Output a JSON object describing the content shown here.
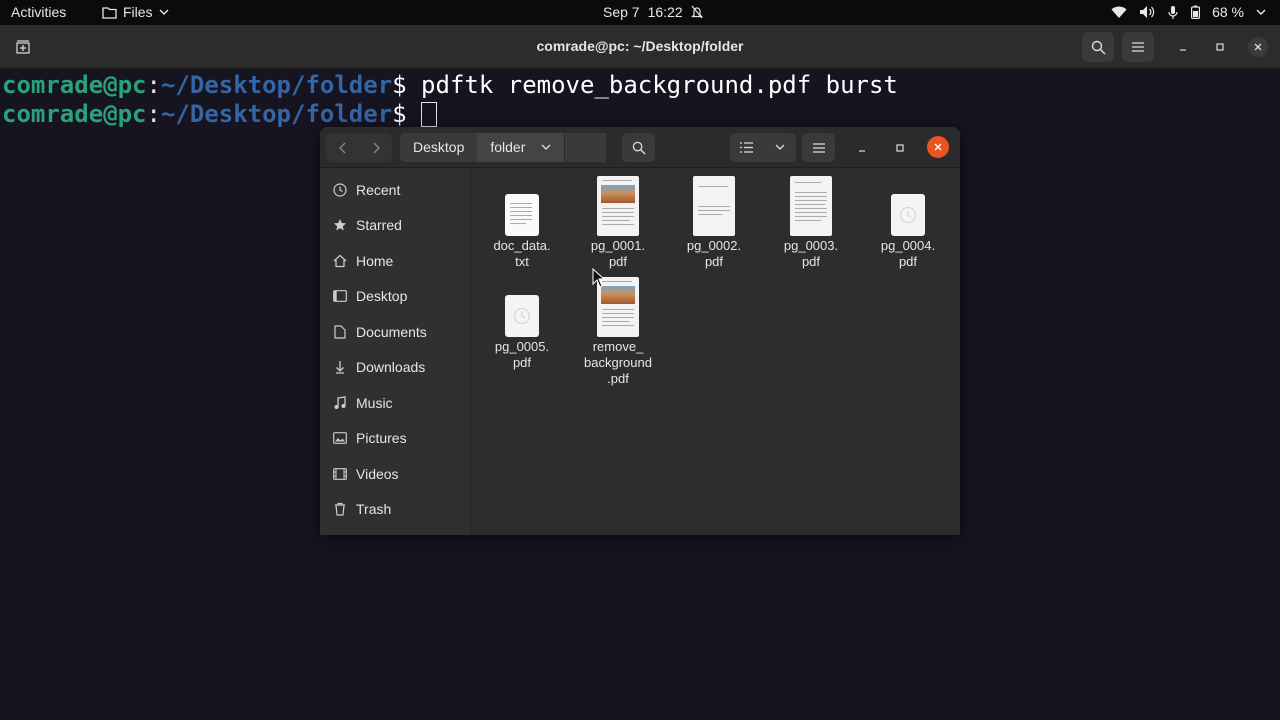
{
  "topbar": {
    "activities": "Activities",
    "app_menu": "Files",
    "date": "Sep 7",
    "time": "16:22",
    "battery": "68 %"
  },
  "terminal": {
    "title": "comrade@pc: ~/Desktop/folder",
    "lines": [
      {
        "user": "comrade@pc",
        "colon": ":",
        "path": "~/Desktop/folder",
        "prompt": "$ ",
        "command": "pdftk remove_background.pdf burst"
      },
      {
        "user": "comrade@pc",
        "colon": ":",
        "path": "~/Desktop/folder",
        "prompt": "$ ",
        "command": ""
      }
    ]
  },
  "files": {
    "breadcrumbs": [
      "Desktop",
      "folder"
    ],
    "sidebar": [
      {
        "label": "Recent",
        "icon": "clock-icon"
      },
      {
        "label": "Starred",
        "icon": "star-icon"
      },
      {
        "label": "Home",
        "icon": "home-icon"
      },
      {
        "label": "Desktop",
        "icon": "desktop-icon"
      },
      {
        "label": "Documents",
        "icon": "document-icon"
      },
      {
        "label": "Downloads",
        "icon": "download-icon"
      },
      {
        "label": "Music",
        "icon": "music-icon"
      },
      {
        "label": "Pictures",
        "icon": "picture-icon"
      },
      {
        "label": "Videos",
        "icon": "video-icon"
      },
      {
        "label": "Trash",
        "icon": "trash-icon"
      }
    ],
    "items": [
      {
        "line1": "doc_data.",
        "line2": "txt",
        "line3": "",
        "thumb": "doc"
      },
      {
        "line1": "pg_0001.",
        "line2": "pdf",
        "line3": "",
        "thumb": "pdf-image"
      },
      {
        "line1": "pg_0002.",
        "line2": "pdf",
        "line3": "",
        "thumb": "pdf-text"
      },
      {
        "line1": "pg_0003.",
        "line2": "pdf",
        "line3": "",
        "thumb": "pdf-text"
      },
      {
        "line1": "pg_0004.",
        "line2": "pdf",
        "line3": "",
        "thumb": "blank"
      },
      {
        "line1": "pg_0005.",
        "line2": "pdf",
        "line3": "",
        "thumb": "blank"
      },
      {
        "line1": "remove_",
        "line2": "background",
        "line3": ".pdf",
        "thumb": "pdf-image"
      }
    ]
  }
}
